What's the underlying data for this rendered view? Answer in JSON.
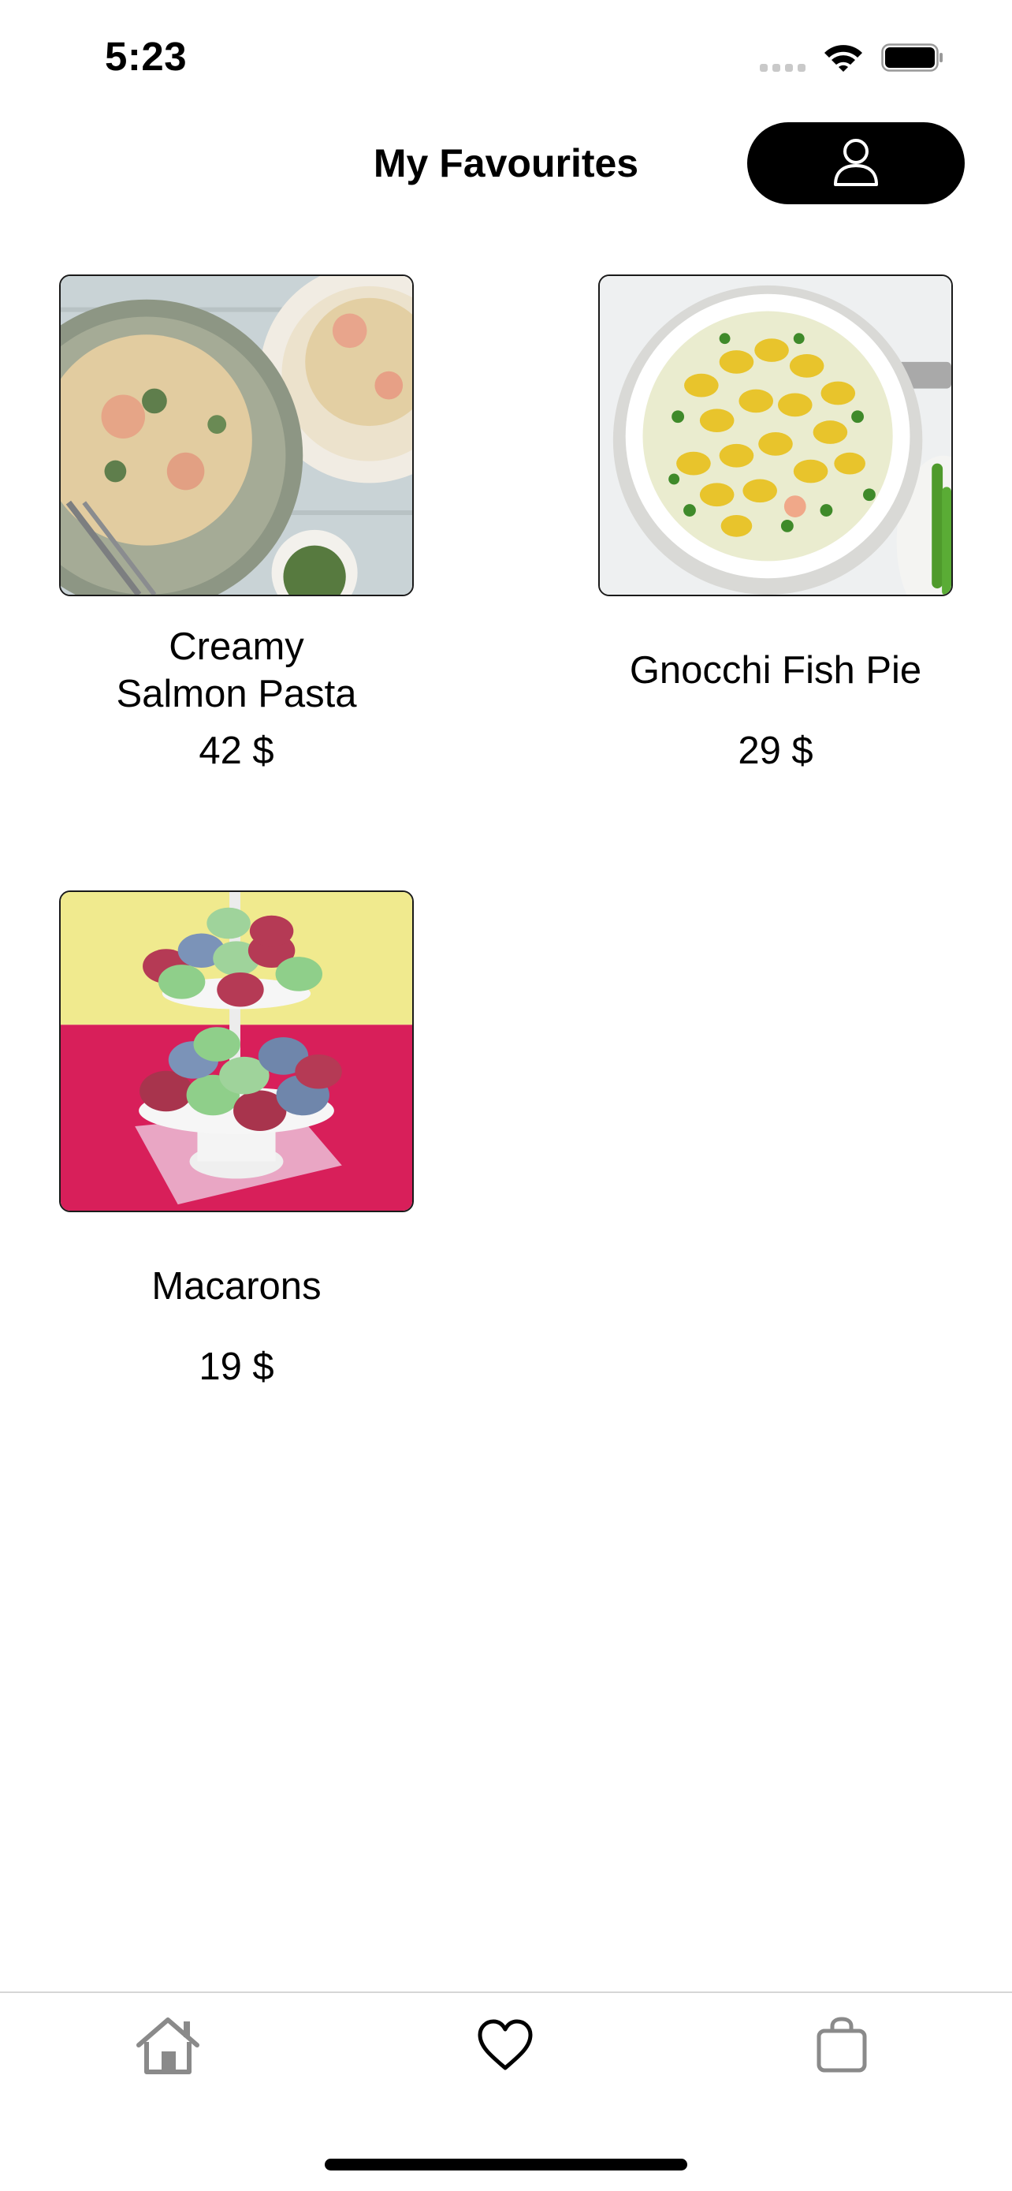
{
  "status_bar": {
    "time": "5:23",
    "icons": [
      "cellular-signal-icon",
      "wifi-icon",
      "battery-icon"
    ]
  },
  "header": {
    "title": "My Favourites",
    "profile_icon": "person-icon"
  },
  "favourites": [
    {
      "name": "Creamy\nSalmon Pasta",
      "price": "42 $",
      "image": "creamy-salmon-pasta-photo"
    },
    {
      "name": "Gnocchi Fish Pie",
      "price": "29 $",
      "image": "gnocchi-fish-pie-photo"
    },
    {
      "name": "Macarons",
      "price": "19 $",
      "image": "macarons-photo"
    }
  ],
  "tab_bar": {
    "tabs": [
      {
        "icon": "home-icon",
        "selected": false
      },
      {
        "icon": "heart-icon",
        "selected": true
      },
      {
        "icon": "shopping-bag-icon",
        "selected": false
      }
    ]
  },
  "colors": {
    "accent": "#000000",
    "inactive_icon": "#8a8a8a",
    "divider": "#d6d6d6"
  }
}
